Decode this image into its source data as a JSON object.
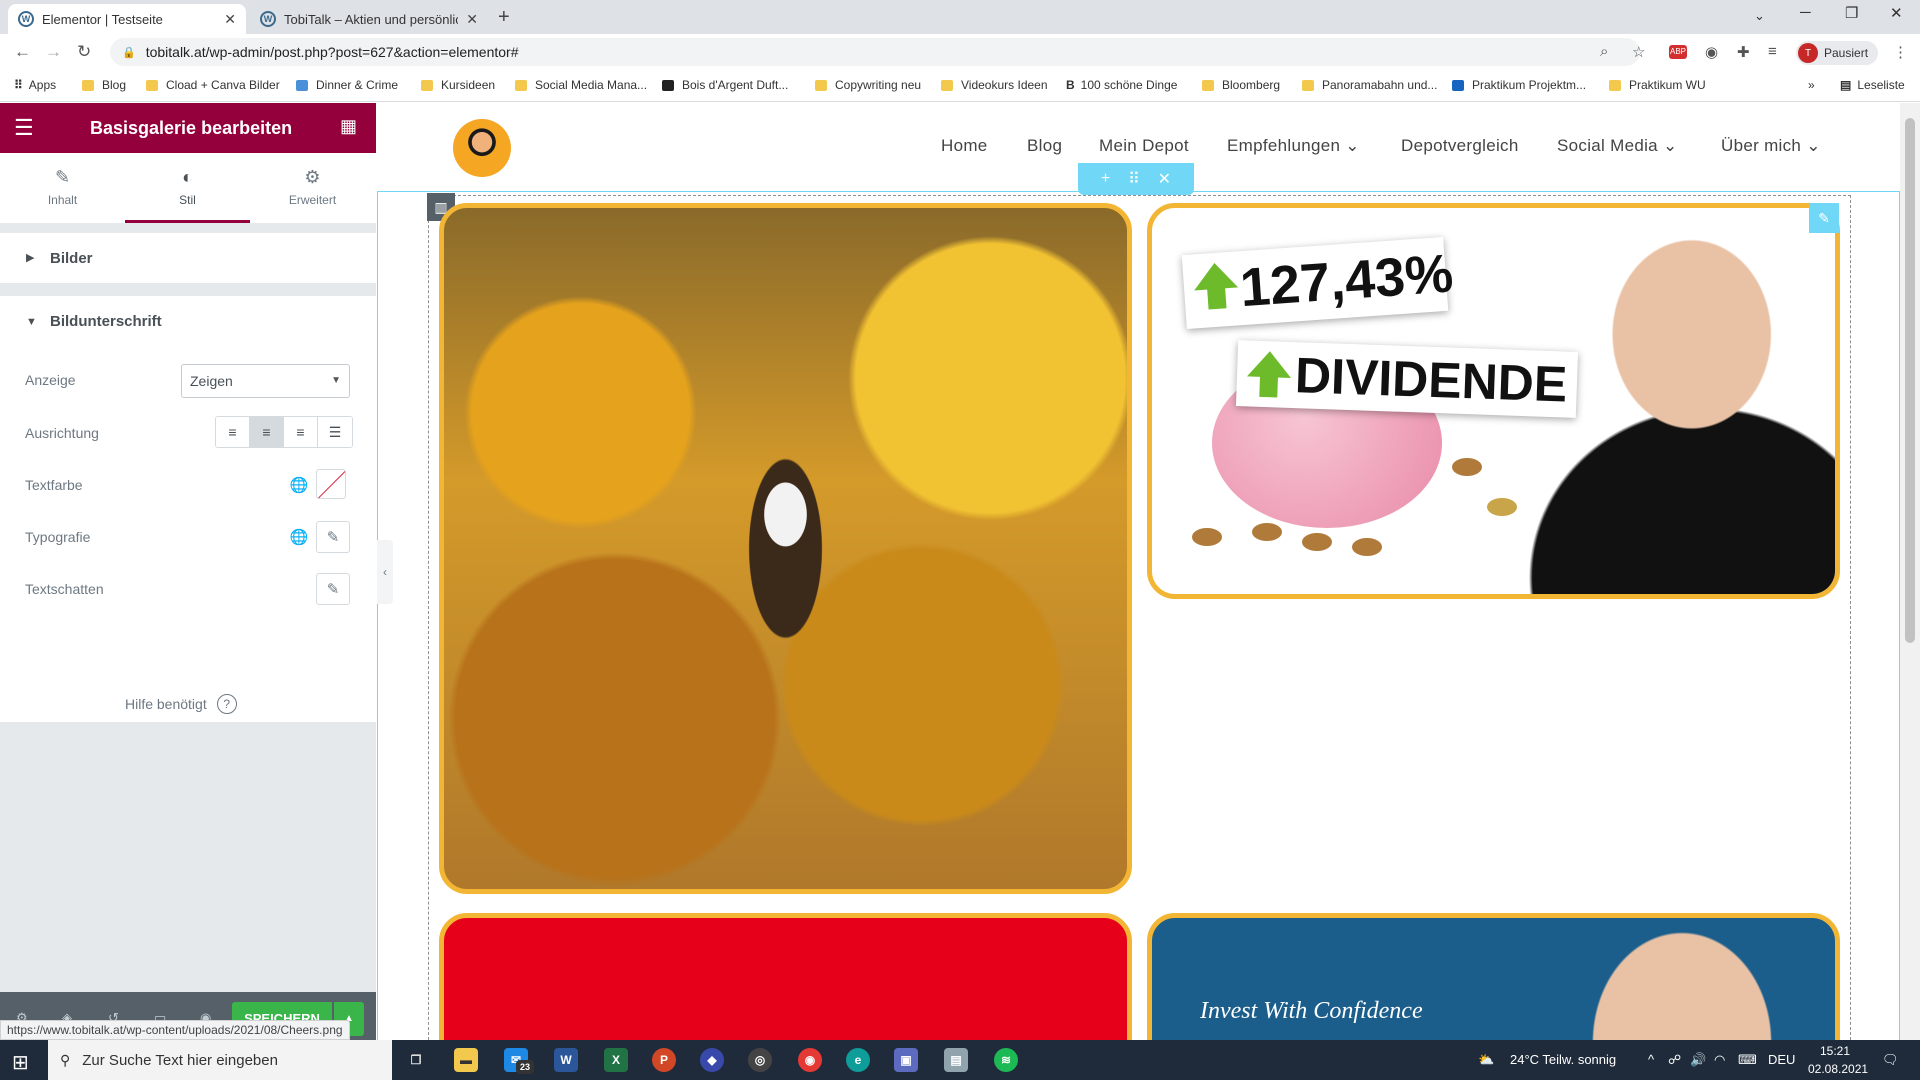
{
  "browser": {
    "tabs": [
      {
        "title": "Elementor | Testseite"
      },
      {
        "title": "TobiTalk – Aktien und persönliche"
      }
    ],
    "url": "tobitalk.at/wp-admin/post.php?post=627&action=elementor#",
    "profile_label": "Pausiert",
    "profile_initial": "T",
    "reading_list": "Leseliste",
    "bookmarks": [
      "Apps",
      "Blog",
      "Cload + Canva Bilder",
      "Dinner & Crime",
      "Kursideen",
      "Social Media Mana...",
      "Bois d'Argent Duft...",
      "Copywriting neu",
      "Videokurs Ideen",
      "100 schöne Dinge",
      "Bloomberg",
      "Panoramabahn und...",
      "Praktikum Projektm...",
      "Praktikum WU"
    ],
    "status_url": "https://www.tobitalk.at/wp-content/uploads/2021/08/Cheers.png"
  },
  "panel": {
    "title": "Basisgalerie bearbeiten",
    "tabs": [
      {
        "label": "Inhalt",
        "icon": "pencil-icon"
      },
      {
        "label": "Stil",
        "icon": "half-circle-icon"
      },
      {
        "label": "Erweitert",
        "icon": "gear-icon"
      }
    ],
    "sections": {
      "bilder": "Bilder",
      "bildunterschrift": "Bildunterschrift"
    },
    "controls": {
      "anzeige_label": "Anzeige",
      "anzeige_value": "Zeigen",
      "ausrichtung_label": "Ausrichtung",
      "textfarbe_label": "Textfarbe",
      "typografie_label": "Typografie",
      "textschatten_label": "Textschatten"
    },
    "help": "Hilfe benötigt",
    "save": "SPEICHERN",
    "accent": "#93003c"
  },
  "site": {
    "nav": [
      "Home",
      "Blog",
      "Mein Depot",
      "Empfehlungen",
      "Depotvergleich",
      "Social Media",
      "Über mich"
    ],
    "gallery": {
      "badge_percent": "127,43%",
      "badge_dividend": "DIVIDENDE",
      "invest_text": "Invest With Confidence"
    }
  },
  "taskbar": {
    "search_placeholder": "Zur Suche Text hier eingeben",
    "weather": "24°C Teilw. sonnig",
    "lang": "DEU",
    "time": "15:21",
    "date": "02.08.2021",
    "mail_badge": "23"
  }
}
